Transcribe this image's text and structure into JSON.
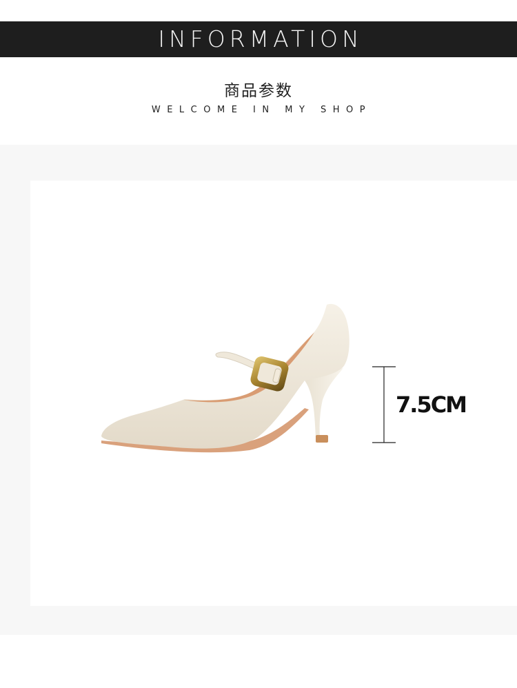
{
  "header": {
    "banner_title": "INFORMATION",
    "subtitle_cn": "商品参数",
    "subtitle_en": "WELCOME IN MY SHOP"
  },
  "product": {
    "image_icon": "pump-shoe-icon",
    "heel_height_label": "7.5CM"
  },
  "colors": {
    "banner_bg": "#1e1e1e",
    "panel_bg": "#f7f7f7",
    "shoe_body": "#ede6d8",
    "buckle": "#b89438",
    "sole": "#d9a17c"
  }
}
